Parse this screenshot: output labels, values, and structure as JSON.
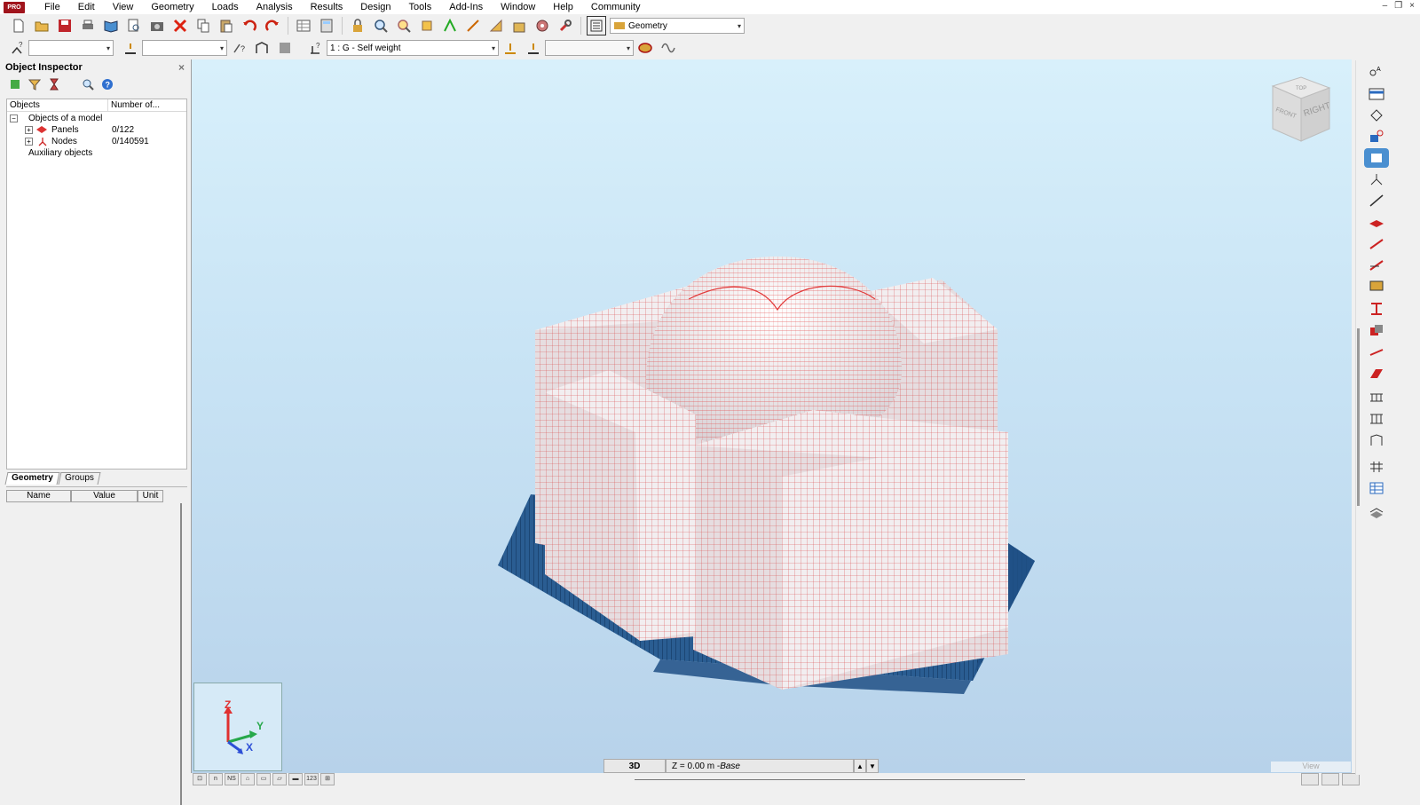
{
  "app": {
    "logo_text": "PRO"
  },
  "menu": [
    "File",
    "Edit",
    "View",
    "Geometry",
    "Loads",
    "Analysis",
    "Results",
    "Design",
    "Tools",
    "Add-Ins",
    "Window",
    "Help",
    "Community"
  ],
  "window_controls": {
    "minimize": "–",
    "restore": "❐",
    "close": "×"
  },
  "toolbar1": {
    "layout_combo": "Geometry"
  },
  "toolbar2": {
    "load_case_combo": "1 : G - Self weight",
    "combo_a": "",
    "combo_b": "",
    "combo_c": ""
  },
  "inspector": {
    "title": "Object Inspector",
    "close": "×",
    "col_objects": "Objects",
    "col_number": "Number of...",
    "tree": {
      "root": "Objects of a model",
      "panels": {
        "label": "Panels",
        "count": "0/122"
      },
      "nodes": {
        "label": "Nodes",
        "count": "0/140591"
      },
      "auxiliary": "Auxiliary objects"
    },
    "tabs": {
      "geometry": "Geometry",
      "groups": "Groups"
    },
    "props": {
      "name": "Name",
      "value": "Value",
      "unit": "Unit"
    }
  },
  "viewcube": {
    "top": "TOP",
    "front": "FRONT",
    "right": "RIGHT"
  },
  "axes": {
    "z": "Z",
    "y": "Y",
    "x": "X"
  },
  "status": {
    "view_mode": "3D",
    "z_level": "Z = 0.00 m - ",
    "z_level_name": "Base",
    "spin_up": "▲",
    "spin_down": "▼"
  },
  "view_label": "View",
  "bottom_toolbar": [
    "⊡",
    "n",
    "NS",
    "⌂",
    "▭",
    "▱",
    "▬",
    "123",
    "⊞"
  ]
}
